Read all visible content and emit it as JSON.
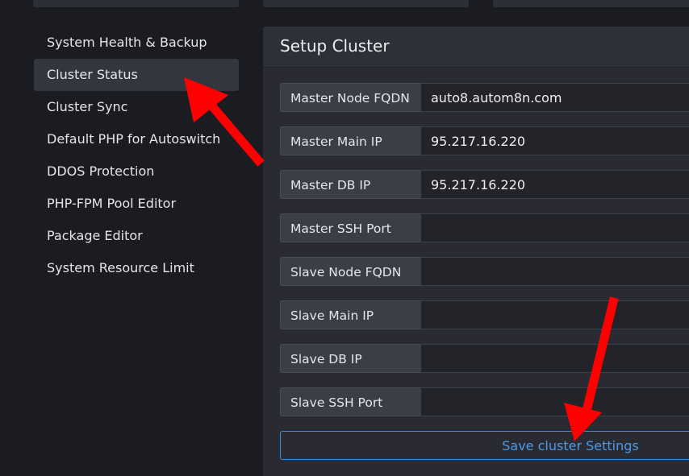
{
  "sidebar": {
    "items": [
      {
        "label": "System Health & Backup",
        "active": false
      },
      {
        "label": "Cluster Status",
        "active": true
      },
      {
        "label": "Cluster Sync",
        "active": false
      },
      {
        "label": "Default PHP for Autoswitch",
        "active": false
      },
      {
        "label": "DDOS Protection",
        "active": false
      },
      {
        "label": "PHP-FPM Pool Editor",
        "active": false
      },
      {
        "label": "Package Editor",
        "active": false
      },
      {
        "label": "System Resource Limit",
        "active": false
      }
    ]
  },
  "panel": {
    "title": "Setup Cluster",
    "fields": [
      {
        "label": "Master Node FQDN",
        "value": "auto8.autom8n.com"
      },
      {
        "label": "Master Main IP",
        "value": "95.217.16.220"
      },
      {
        "label": "Master DB IP",
        "value": "95.217.16.220"
      },
      {
        "label": "Master SSH Port",
        "value": ""
      },
      {
        "label": "Slave Node FQDN",
        "value": ""
      },
      {
        "label": "Slave Main IP",
        "value": ""
      },
      {
        "label": "Slave DB IP",
        "value": ""
      },
      {
        "label": "Slave SSH Port",
        "value": ""
      }
    ],
    "save_label": "Save cluster Settings"
  },
  "colors": {
    "background": "#1b1c21",
    "panel": "#2a2b32",
    "accent": "#3d8bd8",
    "annotation_arrow": "#ff0000"
  }
}
